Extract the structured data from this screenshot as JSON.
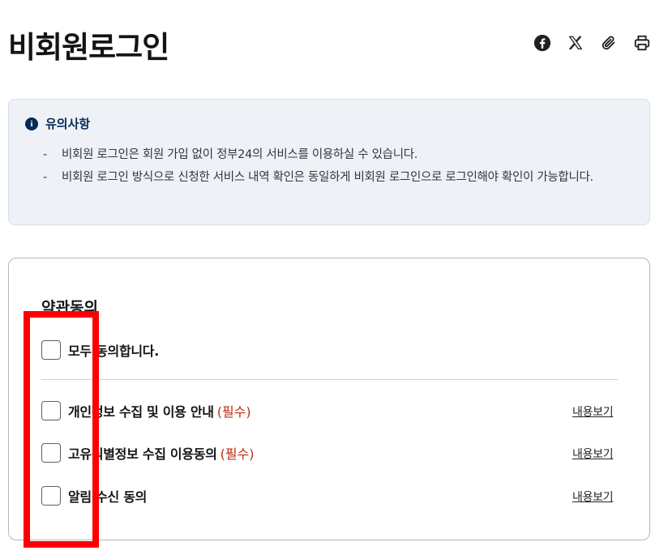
{
  "page": {
    "title": "비회원로그인"
  },
  "share": {
    "icons": [
      "facebook-icon",
      "x-icon",
      "attach-icon",
      "print-icon"
    ]
  },
  "notice": {
    "title": "유의사항",
    "items": [
      "비회원 로그인은 회원 가입 없이 정부24의 서비스를 이용하실 수 있습니다.",
      "비회원 로그인 방식으로 신청한 서비스 내역 확인은 동일하게 비회원 로그인으로 로그인해야 확인이 가능합니다."
    ]
  },
  "terms": {
    "title": "약관동의",
    "agree_all": "모두 동의합니다.",
    "items": [
      {
        "label": "개인정보 수집 및 이용 안내",
        "required": "(필수)",
        "link": "내용보기"
      },
      {
        "label": "고유식별정보 수집 이용동의",
        "required": "(필수)",
        "link": "내용보기"
      },
      {
        "label": "알림 수신 동의",
        "required": "",
        "link": "내용보기"
      }
    ]
  },
  "colors": {
    "accent": "#052b57",
    "required": "#bd2c0f",
    "highlight": "#ff0000"
  }
}
